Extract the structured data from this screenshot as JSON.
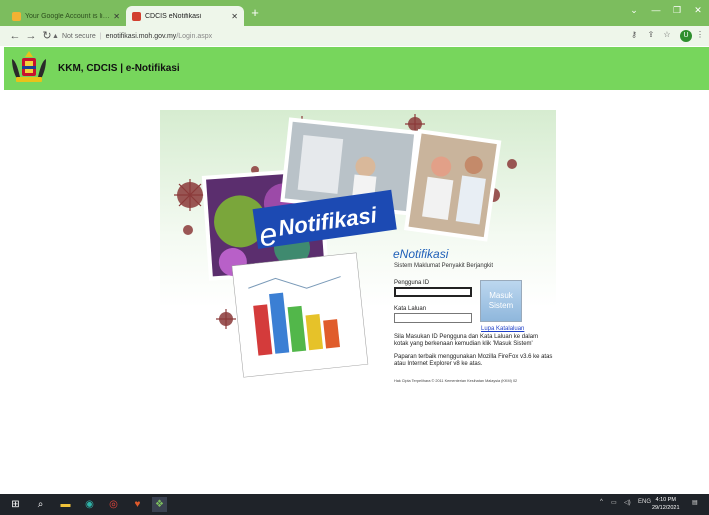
{
  "browser": {
    "tabs": [
      {
        "title": "Your Google Account is live – m",
        "active": false
      },
      {
        "title": "CDCIS eNotifikasi",
        "active": true
      }
    ],
    "url_warning": "Not secure",
    "url_host": "enotifikasi.moh.gov.my",
    "url_path": "/Login.aspx",
    "profile_initial": "U"
  },
  "site": {
    "title": "KKM, CDCIS | e-Notifikasi"
  },
  "banner": {
    "logo_e": "e",
    "logo_word": "Notifikasi"
  },
  "login": {
    "app_title": "eNotifikasi",
    "app_subtitle": "Sistem Maklumat Penyakit Berjangkit",
    "username_label": "Pengguna ID",
    "password_label": "Kata Laluan",
    "submit_line1": "Masuk",
    "submit_line2": "Sistem",
    "forgot_link": "Lupa Katalaluan",
    "instructions": "Sila Masukan ID Pengguna dan Kata Laluan ke dalam kotak yang berkenaan kemudian klik 'Masuk Sistem'",
    "browser_note": "Paparan terbaik menggunakan Mozilla FireFox v3.6 ke atas atau Internet Explorer v8 ke atas.",
    "copyright": "Hak Cipta Terpelihara © 2011 Kementerian Kesihatan Malaysia (KKM) 02"
  },
  "taskbar": {
    "language": "ENG",
    "time": "4:10 PM",
    "date": "29/12/2021"
  },
  "colors": {
    "tab_strip": "#7cbd5e",
    "site_header": "#77d65c",
    "title_blue": "#1f5fb8",
    "taskbar": "#1f2329"
  }
}
